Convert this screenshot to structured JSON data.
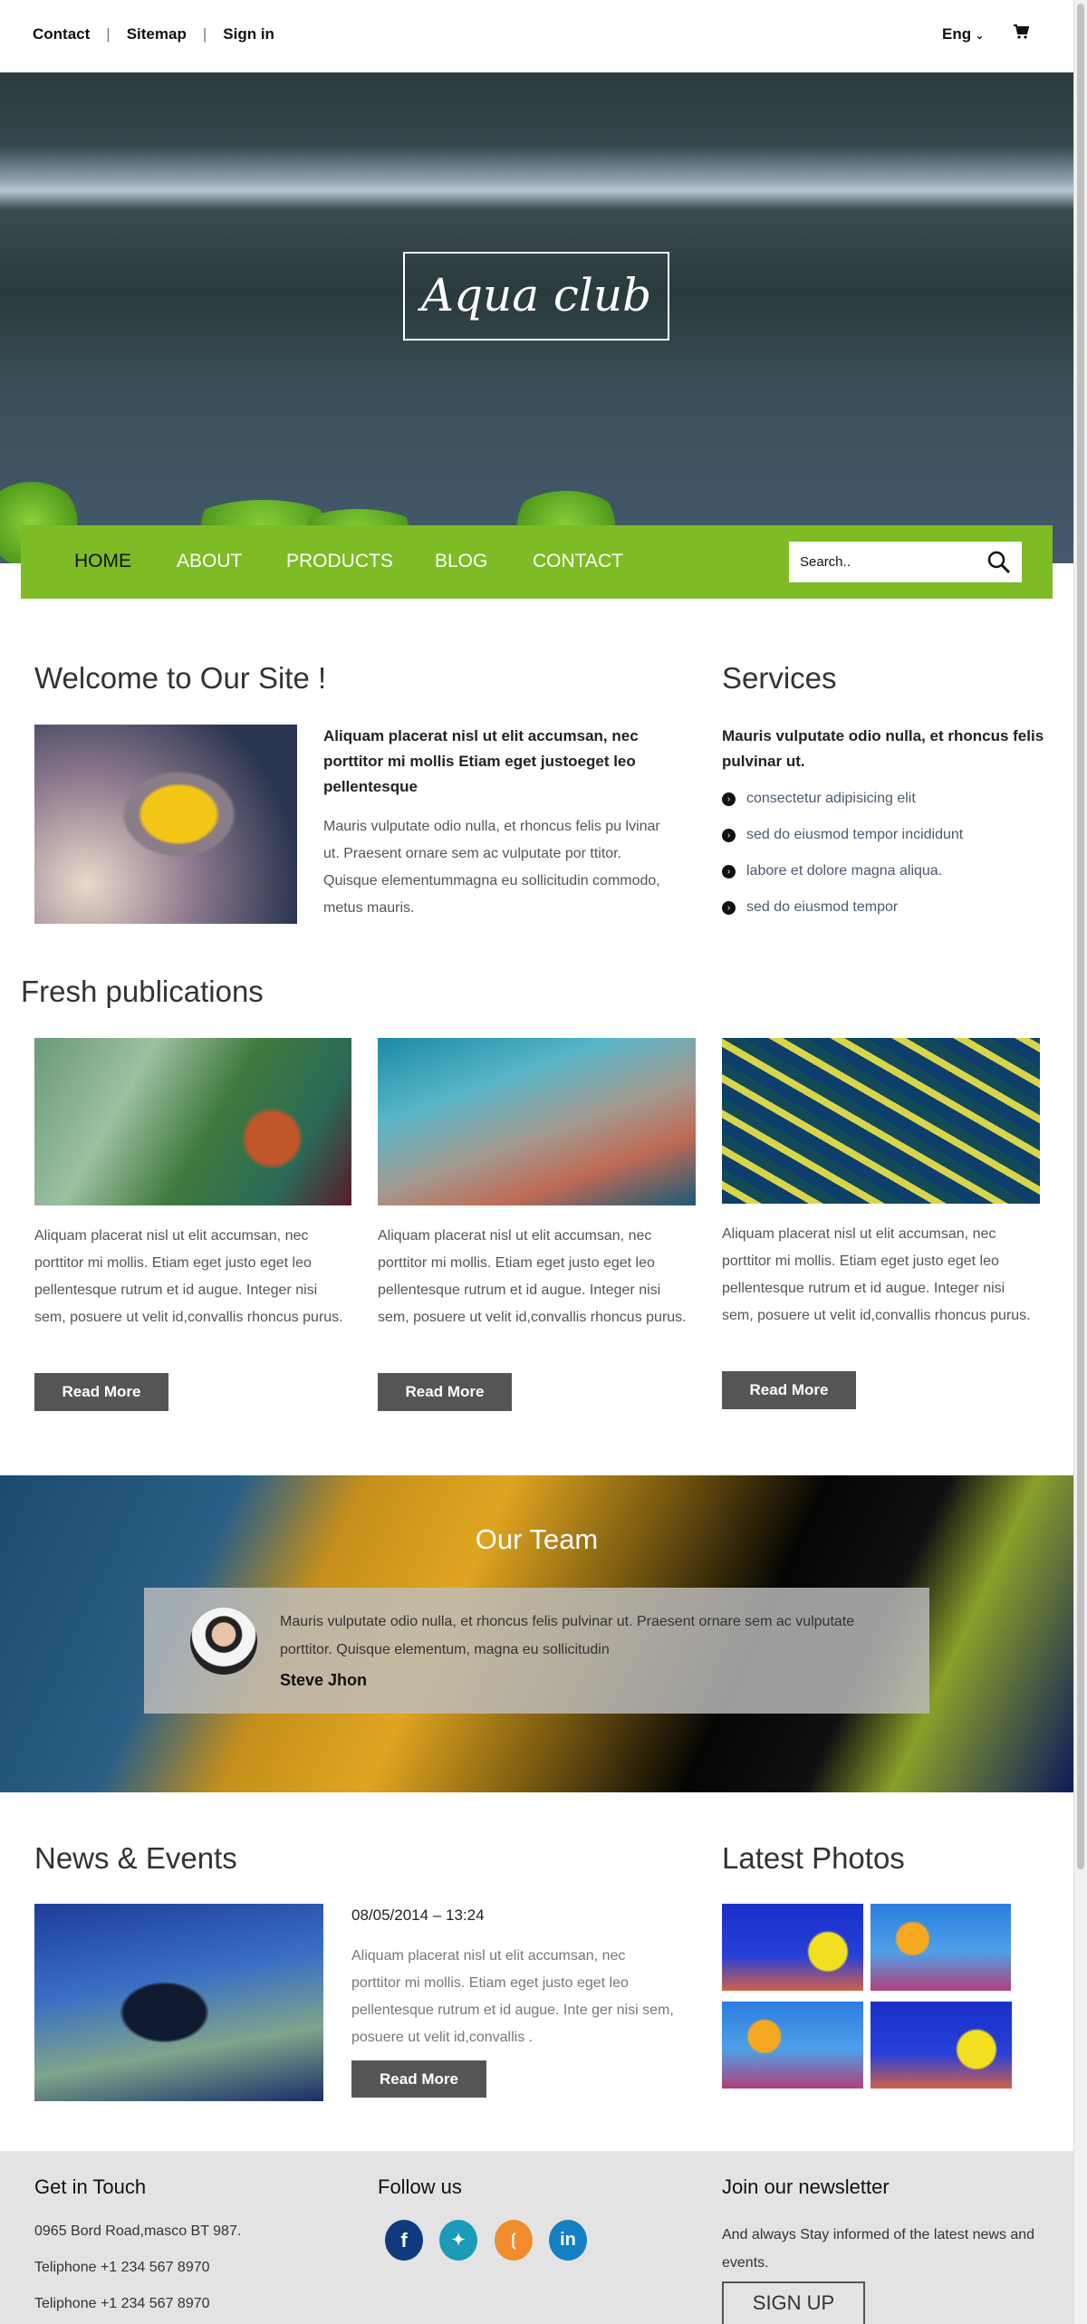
{
  "topbar": {
    "links": [
      "Contact",
      "Sitemap",
      "Sign in"
    ],
    "language": "Eng"
  },
  "hero": {
    "title": "Aqua club"
  },
  "nav": {
    "items": [
      "HOME",
      "ABOUT",
      "PRODUCTS",
      "BLOG",
      "CONTACT"
    ],
    "active": "HOME",
    "search_placeholder": "Search.."
  },
  "welcome": {
    "heading": "Welcome to Our Site !",
    "lead": "Aliquam placerat nisl ut elit accumsan, nec porttitor mi mollis Etiam eget justoeget leo pellentesque",
    "body": "Mauris vulputate odio nulla, et rhoncus felis pu lvinar ut. Praesent ornare sem ac vulputate por ttitor. Quisque elementummagna eu sollicitudin commodo, metus mauris."
  },
  "services": {
    "heading": "Services",
    "lead": "Mauris vulputate odio nulla, et rhoncus felis pulvinar ut.",
    "items": [
      "consectetur adipisicing elit",
      "sed do eiusmod tempor incididunt",
      "labore et dolore magna aliqua.",
      "sed do eiusmod tempor"
    ]
  },
  "publications": {
    "heading": "Fresh publications",
    "items": [
      {
        "text": "Aliquam placerat nisl ut elit accumsan, nec porttitor mi mollis. Etiam eget justo eget leo pellentesque rutrum et id augue. Integer nisi sem, posuere ut velit id,convallis rhoncus purus.",
        "button": "Read More"
      },
      {
        "text": "Aliquam placerat nisl ut elit accumsan, nec porttitor mi mollis. Etiam eget justo eget leo pellentesque rutrum et id augue. Integer nisi sem, posuere ut velit id,convallis rhoncus purus.",
        "button": "Read More"
      },
      {
        "text": "Aliquam placerat nisl ut elit accumsan, nec porttitor mi mollis. Etiam eget justo eget leo pellentesque rutrum et id augue. Integer nisi sem, posuere ut velit id,convallis rhoncus purus.",
        "button": "Read More"
      }
    ]
  },
  "team": {
    "heading": "Our Team",
    "quote": "Mauris vulputate odio nulla, et rhoncus felis pulvinar ut. Praesent ornare sem ac vulputate porttitor. Quisque elementum, magna eu sollicitudin",
    "name": "Steve Jhon"
  },
  "news": {
    "heading": "News & Events",
    "date": "08/05/2014 – 13:24",
    "text": "Aliquam placerat nisl ut elit accumsan, nec porttitor mi mollis. Etiam eget justo eget leo pellentesque rutrum et id augue. Inte ger nisi sem, posuere ut velit id,convallis .",
    "button": "Read More"
  },
  "photos": {
    "heading": "Latest Photos"
  },
  "footer": {
    "contact": {
      "heading": "Get in Touch",
      "lines": [
        "0965 Bord Road,masco BT 987.",
        "Teliphone +1 234 567 8970",
        "Teliphone +1 234 567 8970"
      ]
    },
    "follow": {
      "heading": "Follow us",
      "icons": [
        "facebook-icon",
        "twitter-icon",
        "rss-icon",
        "linkedin-icon"
      ]
    },
    "newsletter": {
      "heading": "Join our newsletter",
      "text": "And always Stay informed of the latest news and events.",
      "button": "SIGN UP"
    }
  },
  "colors": {
    "accent": "#7dbc24",
    "button": "#555555",
    "footer_bg": "#e3e3e3",
    "facebook": "#0f3a7d",
    "twitter": "#1b9bb8",
    "rss": "#f08c2e",
    "linkedin": "#1380c1"
  }
}
